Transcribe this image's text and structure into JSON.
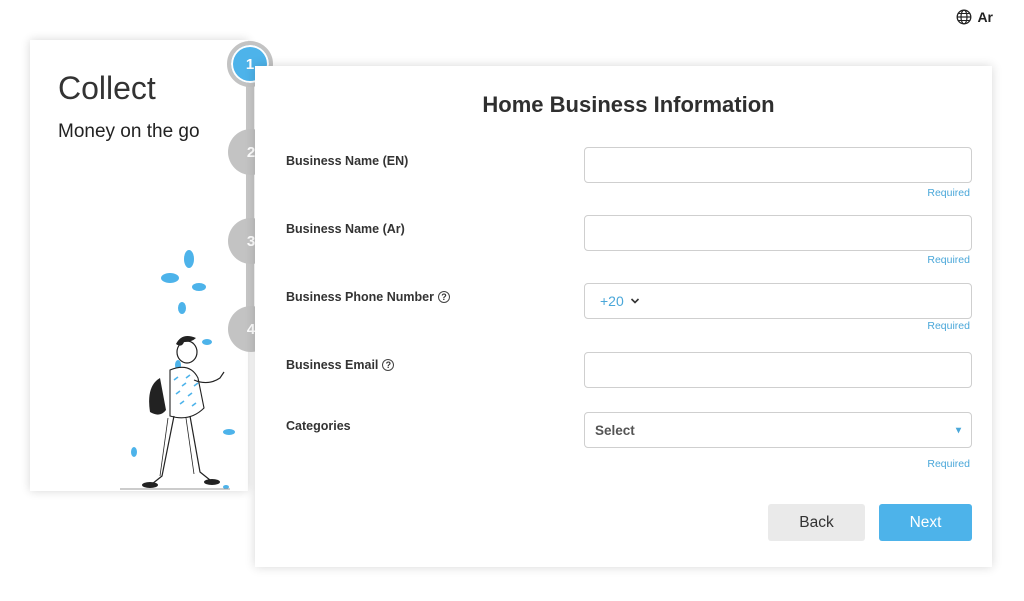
{
  "header": {
    "language_label": "Ar"
  },
  "sidebar": {
    "title": "Collect",
    "subtitle": "Money on the go"
  },
  "stepper": {
    "steps": [
      "1",
      "2",
      "3",
      "4"
    ],
    "active_step": 1
  },
  "form": {
    "title": "Home Business Information",
    "fields": [
      {
        "label": "Business Name (EN)",
        "value": "",
        "note": "Required"
      },
      {
        "label": "Business Name (Ar)",
        "value": "",
        "note": "Required"
      },
      {
        "label": "Business Phone Number",
        "country_code": "+20",
        "value": "",
        "note": "Required"
      },
      {
        "label": "Business Email",
        "value": "",
        "note": ""
      },
      {
        "label": "Categories",
        "selected": "Select",
        "note": "Required"
      }
    ],
    "help_glyph": "?"
  },
  "actions": {
    "back_label": "Back",
    "next_label": "Next"
  },
  "colors": {
    "accent": "#4db3ea",
    "step_inactive": "#c3c3c3",
    "required_text": "#4aa7d9"
  }
}
